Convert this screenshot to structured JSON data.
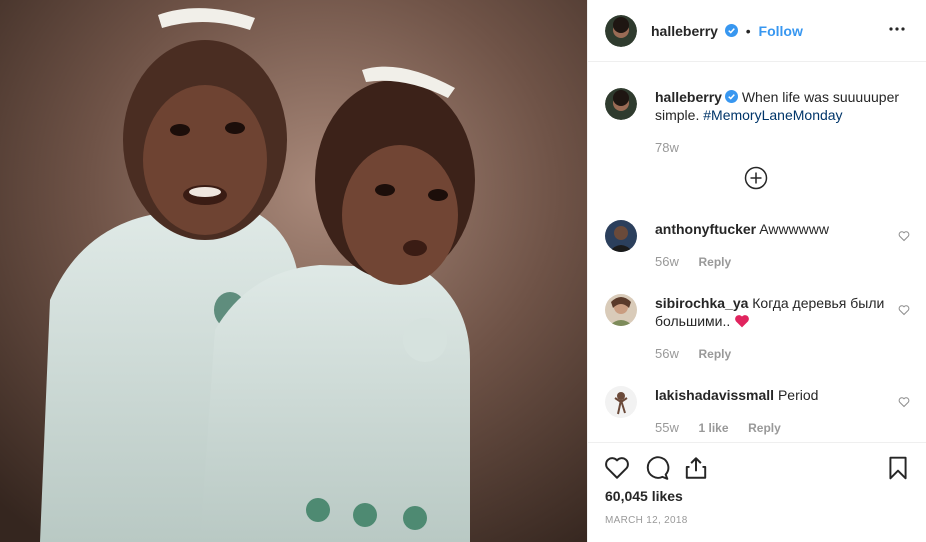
{
  "post": {
    "username": "halleberry",
    "follow_label": "Follow",
    "dot": "•"
  },
  "caption": {
    "username": "halleberry",
    "text": "When life was suuuuuper simple.",
    "hashtag": "#MemoryLaneMonday",
    "time": "78w"
  },
  "comments": [
    {
      "username": "anthonyftucker",
      "text": "Awwwwww",
      "time": "56w",
      "reply": "Reply"
    },
    {
      "username": "sibirochka_ya",
      "text": "Когда деревья были большими..",
      "time": "56w",
      "reply": "Reply"
    },
    {
      "username": "lakishadavissmall",
      "text": "Period",
      "time": "55w",
      "likes": "1 like",
      "reply": "Reply"
    }
  ],
  "footer": {
    "likes": "60,045 likes",
    "date": "MARCH 12, 2018"
  },
  "colors": {
    "link": "#3897f0",
    "hashtag": "#003569",
    "heart_emoji": "#e0245e",
    "verified": "#3897f0"
  }
}
